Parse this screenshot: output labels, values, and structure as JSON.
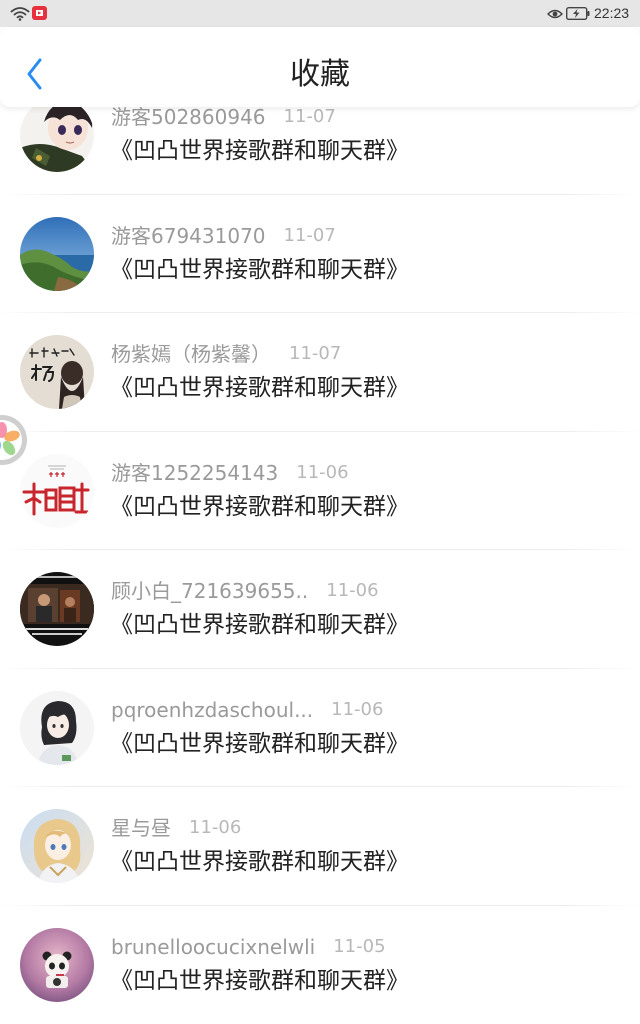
{
  "status_bar": {
    "time": "22:23",
    "wifi_icon": "wifi-icon",
    "app_icon": "app-notification-icon",
    "eye_icon": "eye-comfort-icon",
    "battery_icon": "battery-charging-icon"
  },
  "header": {
    "title": "收藏",
    "back_icon": "chevron-left-icon"
  },
  "colors": {
    "accent": "#2a8cf0",
    "title_text": "#222222",
    "secondary_text": "#9a9a9a",
    "date_text": "#b8b8b8",
    "status_bar_bg": "#e6e6e6"
  },
  "favorites": [
    {
      "user": "游客502860946",
      "date": "11-07",
      "title": "《凹凸世界接歌群和聊天群》"
    },
    {
      "user": "游客679431070",
      "date": "11-07",
      "title": "《凹凸世界接歌群和聊天群》"
    },
    {
      "user": "杨紫嫣（杨紫馨）",
      "date": "11-07",
      "title": "《凹凸世界接歌群和聊天群》"
    },
    {
      "user": "游客1252254143",
      "date": "11-06",
      "title": "《凹凸世界接歌群和聊天群》"
    },
    {
      "user": "顾小白_721639655..",
      "date": "11-06",
      "title": "《凹凸世界接歌群和聊天群》"
    },
    {
      "user": "pqroenhzdaschoul...",
      "date": "11-06",
      "title": "《凹凸世界接歌群和聊天群》"
    },
    {
      "user": "星与昼",
      "date": "11-06",
      "title": "《凹凸世界接歌群和聊天群》"
    },
    {
      "user": "brunelloocucixnelwli",
      "date": "11-05",
      "title": "《凹凸世界接歌群和聊天群》"
    }
  ],
  "floating_button": {
    "icon": "flower-assistant-icon"
  }
}
